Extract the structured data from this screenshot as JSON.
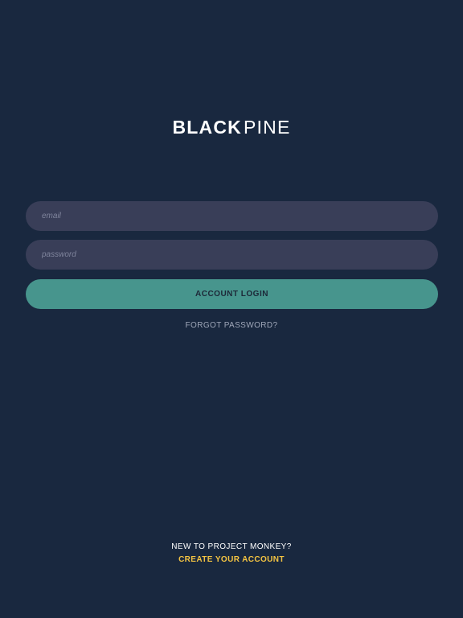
{
  "brand": {
    "strong": "BLACK",
    "light": "PINE"
  },
  "login_form": {
    "email_placeholder": "email",
    "password_placeholder": "password",
    "login_button_label": "ACCOUNT LOGIN",
    "forgot_password_label": "FORGOT PASSWORD?"
  },
  "signup": {
    "prompt": "NEW TO PROJECT MONKEY?",
    "create_account_label": "CREATE YOUR ACCOUNT"
  },
  "colors": {
    "background": "#19283f",
    "input_background": "#393e58",
    "primary_button": "#47958d",
    "accent_link": "#f4c442"
  }
}
